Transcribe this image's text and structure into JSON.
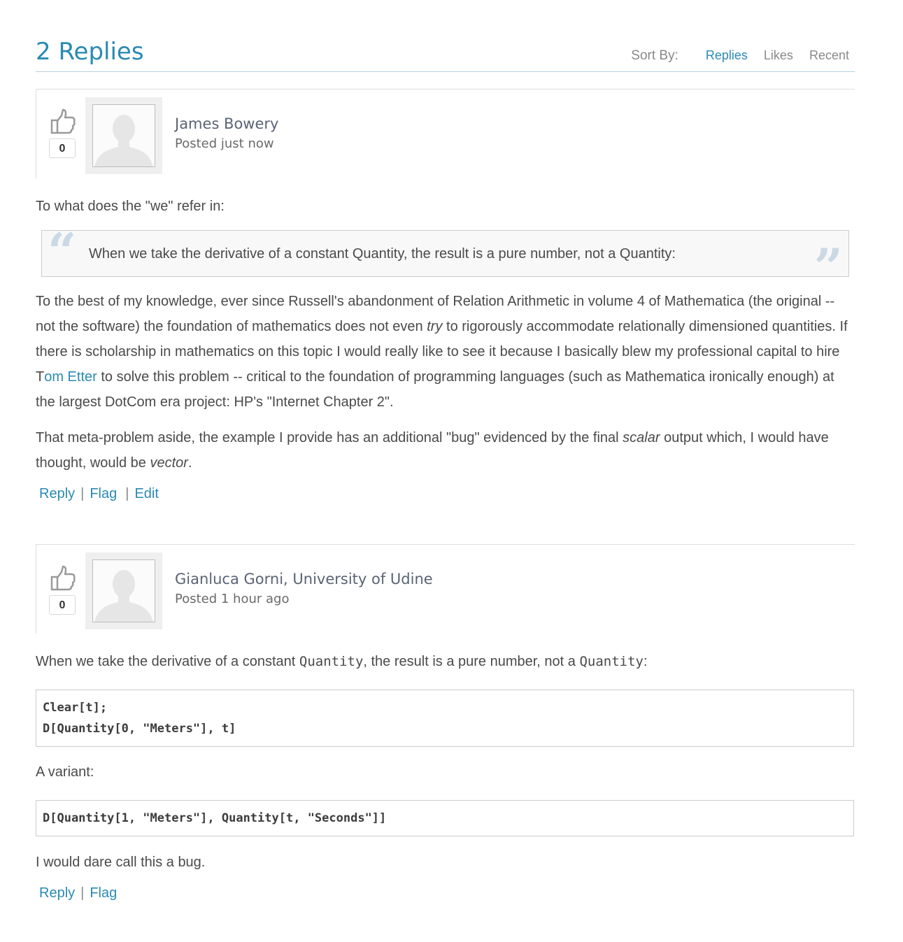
{
  "header": {
    "title": "2 Replies",
    "sort_label": "Sort By:",
    "sort_options": [
      {
        "label": "Replies",
        "active": true
      },
      {
        "label": "Likes",
        "active": false
      },
      {
        "label": "Recent",
        "active": false
      }
    ]
  },
  "colors": {
    "accent": "#2a8ab3",
    "text": "#4a4a4a",
    "quote_mark": "#cbd9e6",
    "divider": "#b7cfe0"
  },
  "replies": [
    {
      "author": "James Bowery",
      "posted": "Posted just now",
      "likes": "0",
      "intro": "To what does the \"we\" refer in:",
      "quote": "When we take the derivative of a constant Quantity, the result is a pure number, not a Quantity:",
      "para1": {
        "a": "To the best of my knowledge, ever since Russell's abandonment of Relation Arithmetic in volume 4 of Mathematica (the original -- not the software) the foundation of mathematics does not even ",
        "em": "try",
        "b": " to rigorously accommodate relationally dimensioned quantities. If there is scholarship in mathematics on this topic I would really like to see it because I basically blew my professional capital to hire T",
        "link": "om Etter",
        "c": " to solve this problem -- critical to the foundation of programming languages (such as Mathematica ironically enough) at the largest DotCom era project: HP's \"Internet Chapter 2\"."
      },
      "para2": {
        "a": "That meta-problem aside, the example I provide has an additional \"bug\" evidenced by the final ",
        "em1": "scalar",
        "b": " output which, I would have thought, would be ",
        "em2": "vector",
        "c": "."
      },
      "actions": [
        "Reply",
        "Flag",
        "Edit"
      ]
    },
    {
      "author": "Gianluca Gorni, University of Udine",
      "posted": "Posted 1 hour ago",
      "likes": "0",
      "intro": {
        "a": "When we take the derivative of a constant ",
        "code1": "Quantity",
        "b": ", the result is a pure number, not a ",
        "code2": "Quantity",
        "c": ":"
      },
      "code_block_1": [
        "Clear[t];",
        "D[Quantity[0, \"Meters\"], t]"
      ],
      "variant_label": "A variant:",
      "code_block_2": [
        "D[Quantity[1, \"Meters\"], Quantity[t, \"Seconds\"]]"
      ],
      "closing": "I would dare call this a bug.",
      "actions": [
        "Reply",
        "Flag"
      ]
    }
  ]
}
